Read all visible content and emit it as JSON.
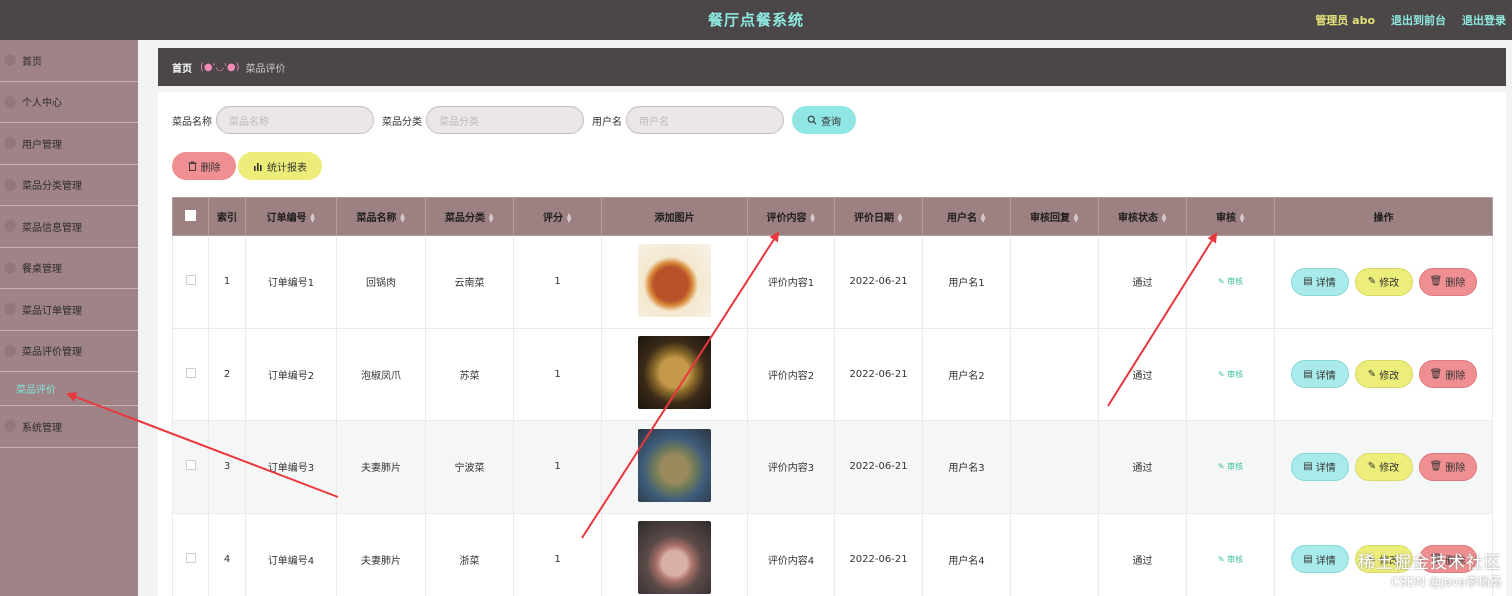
{
  "header": {
    "title": "餐厅点餐系统",
    "admin": "管理员 abo",
    "to_front": "退出到前台",
    "logout": "退出登录"
  },
  "sidebar": {
    "items": [
      {
        "label": "首页"
      },
      {
        "label": "个人中心"
      },
      {
        "label": "用户管理"
      },
      {
        "label": "菜品分类管理"
      },
      {
        "label": "菜品信息管理"
      },
      {
        "label": "餐桌管理"
      },
      {
        "label": "菜品订单管理"
      },
      {
        "label": "菜品评价管理"
      }
    ],
    "subitem": "菜品评价",
    "last_item": "系统管理"
  },
  "breadcrumb": {
    "home": "首页",
    "emoji": "(●'◡'●)",
    "current": "菜品评价"
  },
  "search": {
    "name_label": "菜品名称",
    "name_placeholder": "菜品名称",
    "category_label": "菜品分类",
    "category_placeholder": "菜品分类",
    "user_label": "用户名",
    "user_placeholder": "用户名",
    "query_button": "查询"
  },
  "actions": {
    "delete": "删除",
    "report": "统计报表"
  },
  "table": {
    "headers": [
      "索引",
      "订单编号",
      "菜品名称",
      "菜品分类",
      "评分",
      "添加图片",
      "评价内容",
      "评价日期",
      "用户名",
      "审核回复",
      "审核状态",
      "审核",
      "操作"
    ],
    "rows": [
      {
        "index": "1",
        "order": "订单编号1",
        "dish": "回锅肉",
        "category": "云南菜",
        "score": "1",
        "content": "评价内容1",
        "date": "2022-06-21",
        "user": "用户名1",
        "reply": "",
        "status": "通过",
        "audit": "审核"
      },
      {
        "index": "2",
        "order": "订单编号2",
        "dish": "泡椒凤爪",
        "category": "苏菜",
        "score": "1",
        "content": "评价内容2",
        "date": "2022-06-21",
        "user": "用户名2",
        "reply": "",
        "status": "通过",
        "audit": "审核"
      },
      {
        "index": "3",
        "order": "订单编号3",
        "dish": "夫妻肺片",
        "category": "宁波菜",
        "score": "1",
        "content": "评价内容3",
        "date": "2022-06-21",
        "user": "用户名3",
        "reply": "",
        "status": "通过",
        "audit": "审核"
      },
      {
        "index": "4",
        "order": "订单编号4",
        "dish": "夫妻肺片",
        "category": "浙菜",
        "score": "1",
        "content": "评价内容4",
        "date": "2022-06-21",
        "user": "用户名4",
        "reply": "",
        "status": "通过",
        "audit": "审核"
      }
    ],
    "op_detail": "详情",
    "op_edit": "修改",
    "op_delete": "删除"
  },
  "watermark": {
    "line1": "稀土掘金技术社区",
    "line2": "CSDN @java李杨勇"
  },
  "colors": {
    "topbar": "#4b4648",
    "sidebar": "#a08386",
    "table_header": "#9c8082",
    "accent_cyan": "#8fe6e4",
    "accent_yellow": "#ecec78",
    "accent_red": "#ef8f92",
    "annotation_arrow": "#e8383d"
  }
}
